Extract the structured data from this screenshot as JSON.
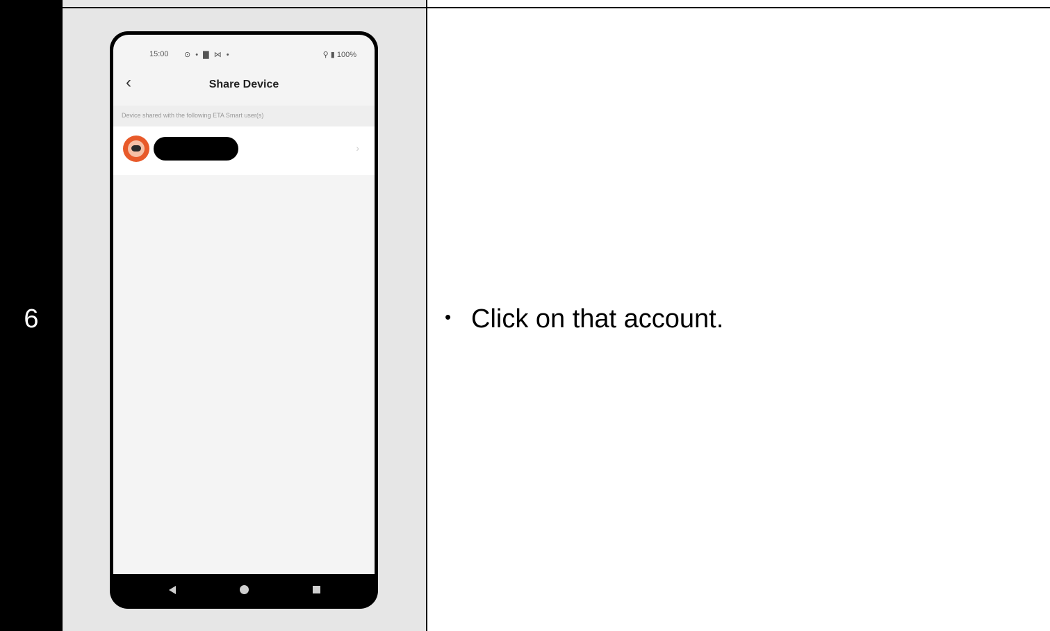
{
  "step": {
    "number": "6"
  },
  "instruction": {
    "bullet": "•",
    "text": "Click on that account."
  },
  "phone": {
    "status_bar": {
      "time": "15:00",
      "icons": "⊙ • ▇ ⋈ •",
      "battery": "⚲ ▮ 100%"
    },
    "back_icon": "‹",
    "title": "Share Device",
    "subtitle": "Device shared with the following ETA Smart user(s)",
    "shared_users": [
      {
        "name": "",
        "redacted": true
      }
    ],
    "chevron": "›"
  },
  "colors": {
    "step_column": "#000000",
    "image_column": "#e6e6e6",
    "avatar_accent": "#e85a2a",
    "screen_background": "#f4f4f4"
  }
}
